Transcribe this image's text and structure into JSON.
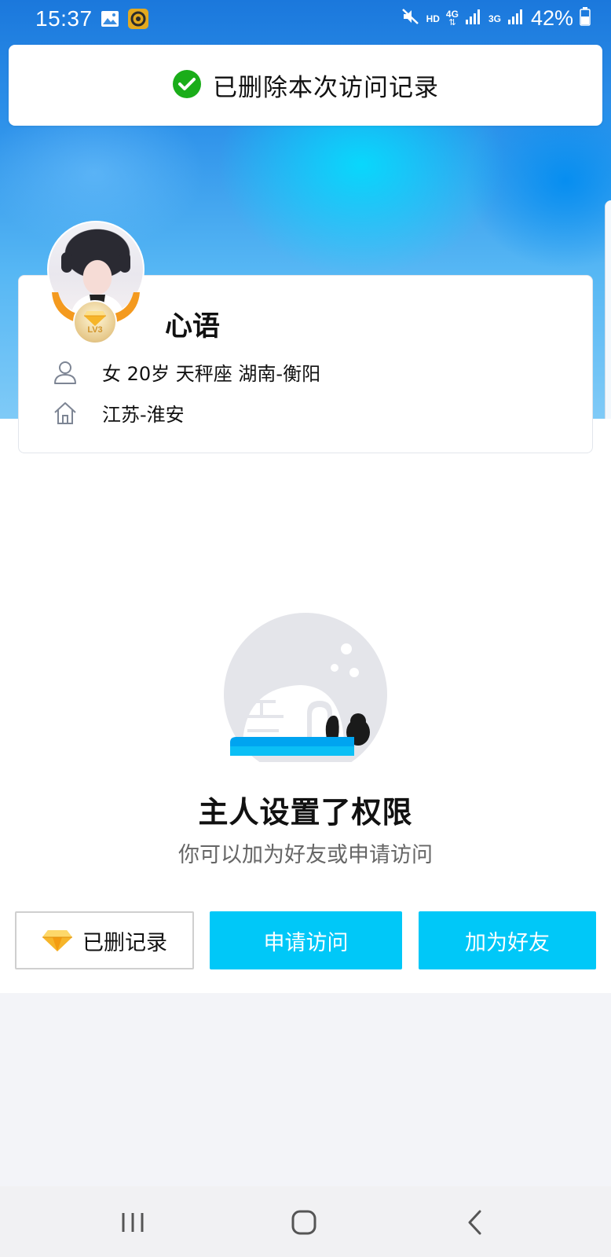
{
  "status_bar": {
    "time": "15:37",
    "network_hd": "HD",
    "network_4g": "4G",
    "network_3g": "3G",
    "battery": "42%"
  },
  "toast": {
    "icon": "check-circle-icon",
    "message": "已删除本次访问记录",
    "accent": "#1aad19"
  },
  "profile": {
    "nickname": "心语",
    "level_label": "LV3",
    "basic_info": "女 20岁 天秤座 湖南-衡阳",
    "hometown": "江苏-淮安"
  },
  "locked": {
    "title": "主人设置了权限",
    "subtitle": "你可以加为好友或申请访问"
  },
  "actions": {
    "record_label": "已删记录",
    "apply_label": "申请访问",
    "add_friend_label": "加为好友",
    "primary_color": "#00c8f8"
  },
  "nav": {
    "recent": "recent-apps-icon",
    "home": "home-icon",
    "back": "back-icon"
  }
}
